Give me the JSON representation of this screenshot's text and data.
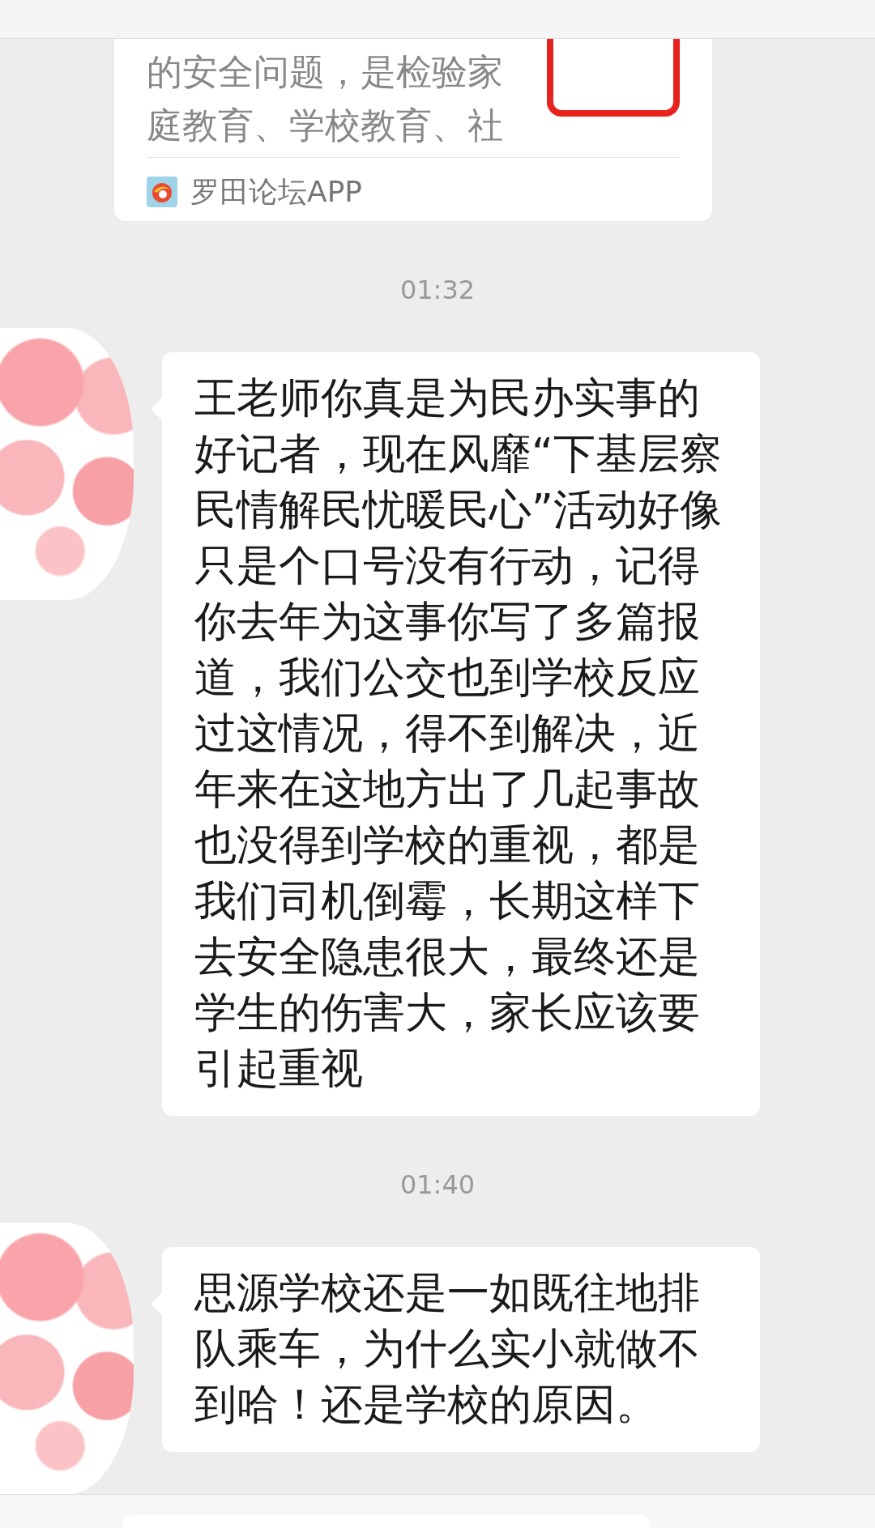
{
  "top_card": {
    "summary_lines": [
      "的安全问题，是检验家",
      "庭教育、学校教育、社"
    ],
    "source": "罗田论坛APP"
  },
  "messages": [
    {
      "time": "01:32",
      "text": "王老师你真是为民办实事的好记者，现在风靡“下基层察民情解民忧暖民心”活动好像只是个口号没有行动，记得你去年为这事你写了多篇报道，我们公交也到学校反应过这情况，得不到解决，近年来在这地方出了几起事故也没得到学校的重视，都是我们司机倒霉，长期这样下去安全隐患很大，最终还是学生的伤害大，家长应该要引起重视"
    },
    {
      "time": "01:40",
      "text": "思源学校还是一如既往地排队乘车，为什么实小就做不到哈！还是学校的原因。"
    }
  ]
}
